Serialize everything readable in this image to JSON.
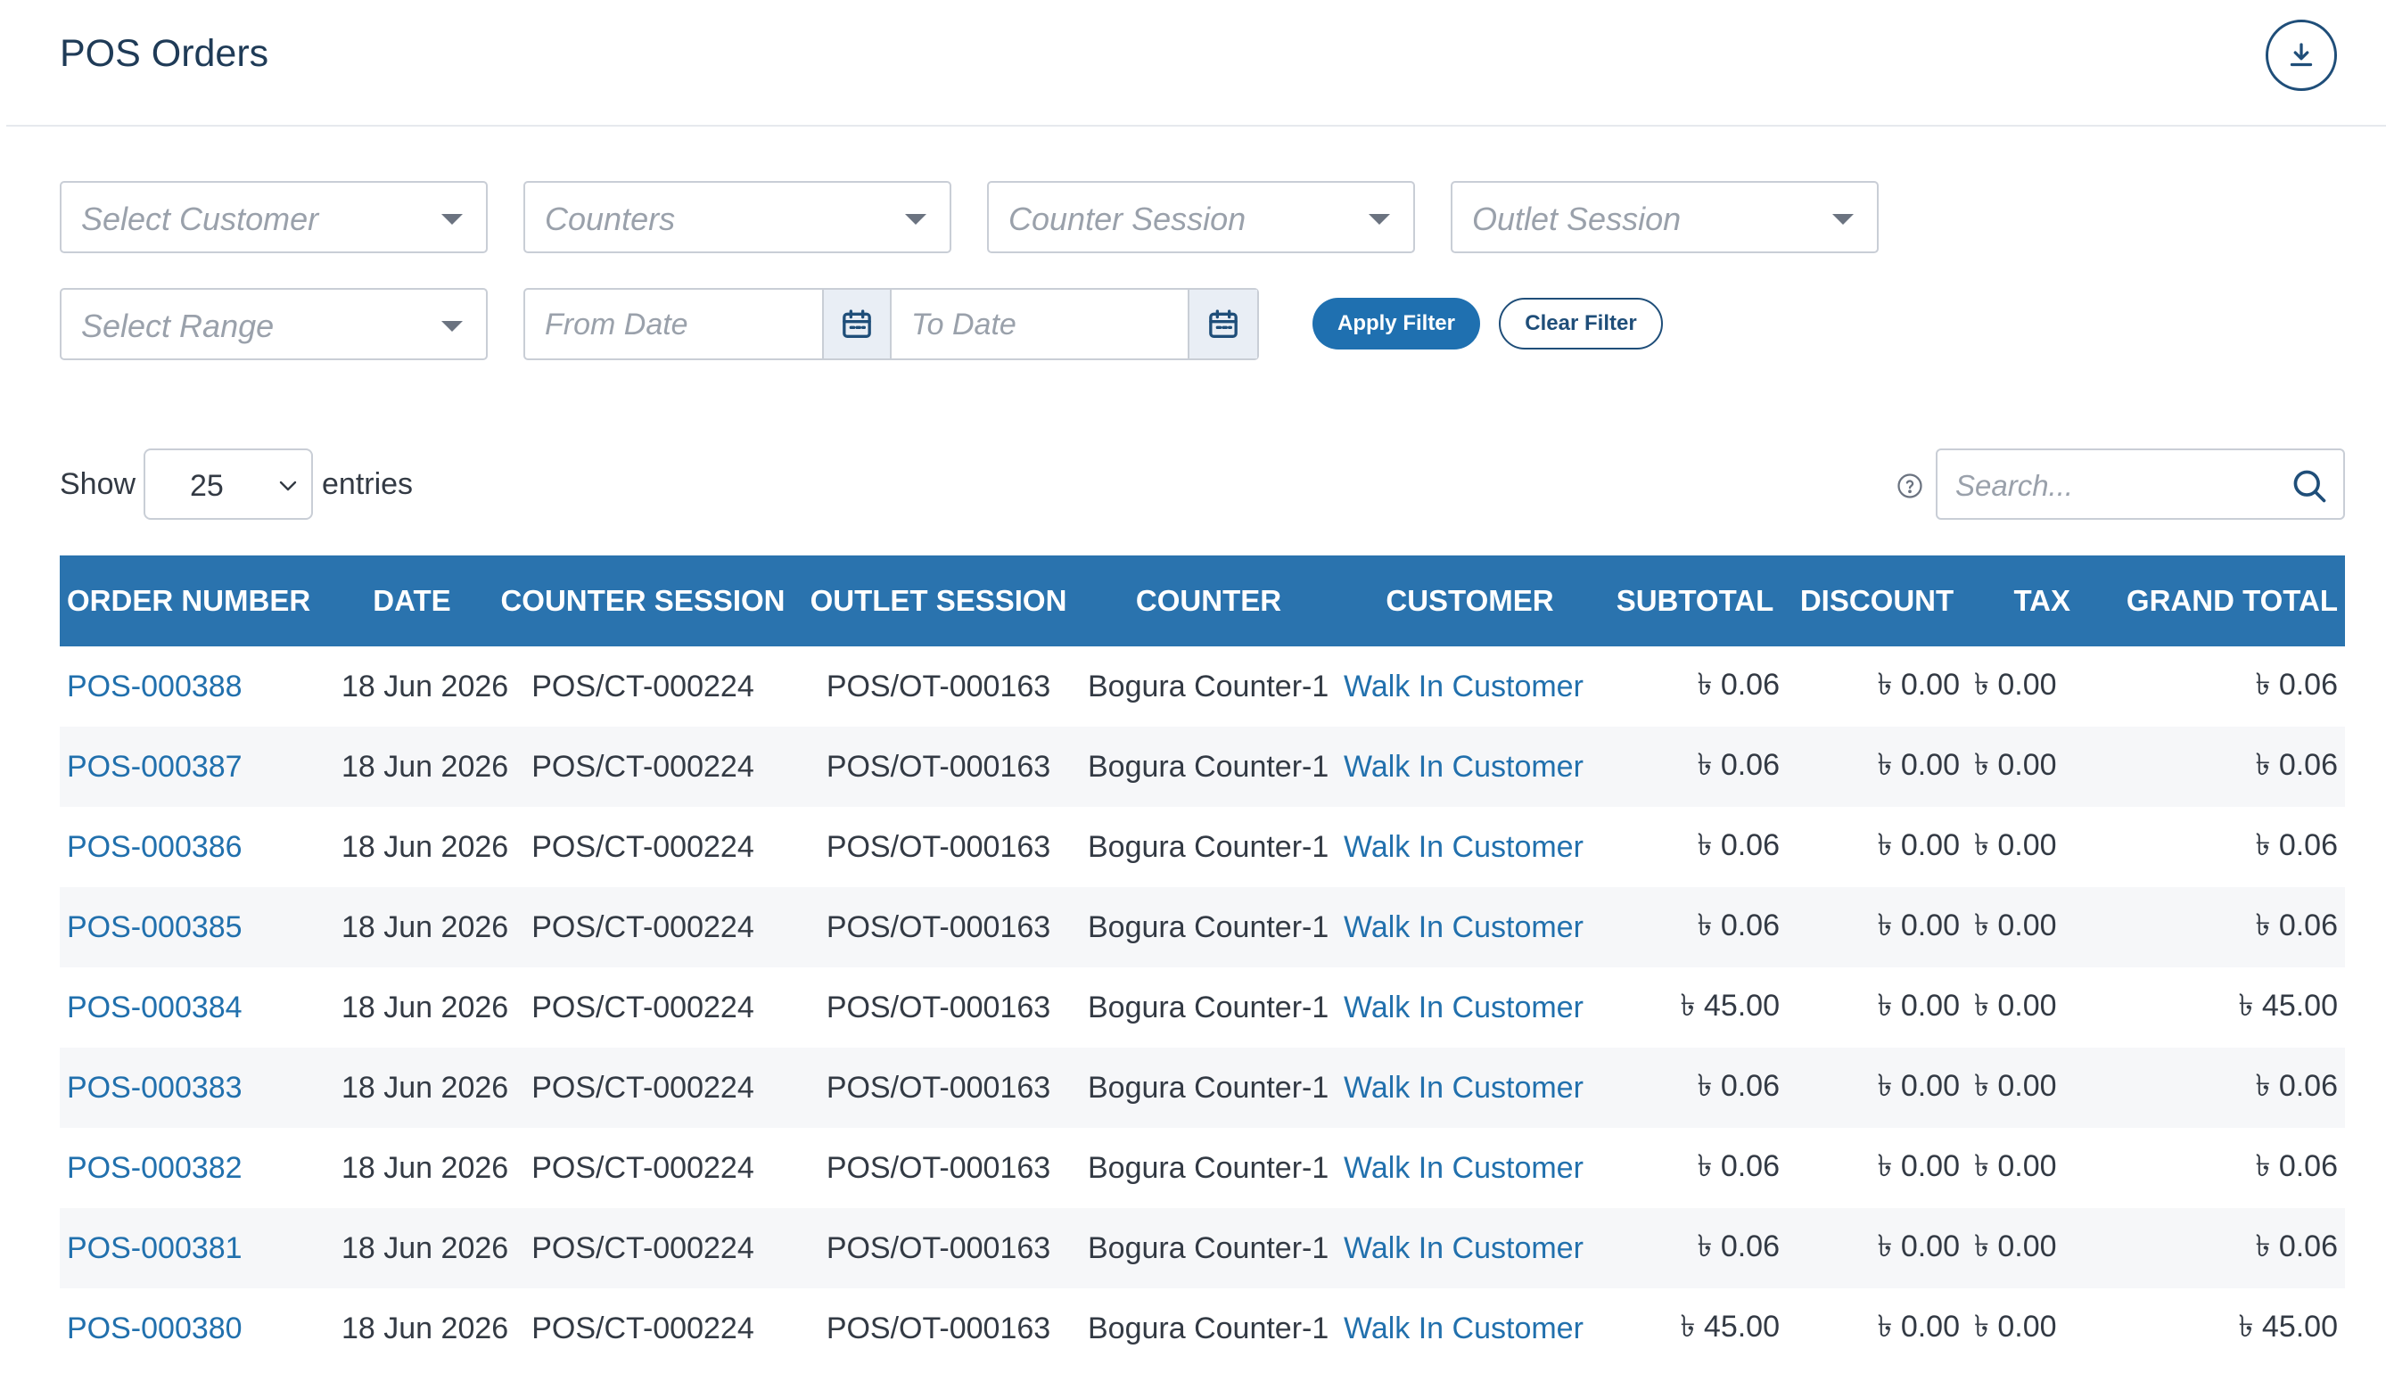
{
  "header": {
    "title": "POS Orders",
    "download_icon": "download-icon"
  },
  "filters": {
    "customer_placeholder": "Select Customer",
    "counters_placeholder": "Counters",
    "counter_session_placeholder": "Counter Session",
    "outlet_session_placeholder": "Outlet Session",
    "range_placeholder": "Select Range",
    "from_date_placeholder": "From Date",
    "to_date_placeholder": "To Date",
    "apply_label": "Apply Filter",
    "clear_label": "Clear Filter"
  },
  "list_controls": {
    "show_label": "Show",
    "entries_value": "25",
    "entries_label": "entries",
    "search_placeholder": "Search..."
  },
  "table": {
    "columns": [
      "ORDER NUMBER",
      "DATE",
      "COUNTER SESSION",
      "OUTLET SESSION",
      "COUNTER",
      "CUSTOMER",
      "SUBTOTAL",
      "DISCOUNT",
      "TAX",
      "GRAND TOTAL"
    ],
    "rows": [
      [
        "POS-000388",
        "18 Jun 2026",
        "POS/CT-000224",
        "POS/OT-000163",
        "Bogura Counter-1",
        "Walk In Customer",
        "৳ 0.06",
        "৳ 0.00",
        "৳ 0.00",
        "৳ 0.06"
      ],
      [
        "POS-000387",
        "18 Jun 2026",
        "POS/CT-000224",
        "POS/OT-000163",
        "Bogura Counter-1",
        "Walk In Customer",
        "৳ 0.06",
        "৳ 0.00",
        "৳ 0.00",
        "৳ 0.06"
      ],
      [
        "POS-000386",
        "18 Jun 2026",
        "POS/CT-000224",
        "POS/OT-000163",
        "Bogura Counter-1",
        "Walk In Customer",
        "৳ 0.06",
        "৳ 0.00",
        "৳ 0.00",
        "৳ 0.06"
      ],
      [
        "POS-000385",
        "18 Jun 2026",
        "POS/CT-000224",
        "POS/OT-000163",
        "Bogura Counter-1",
        "Walk In Customer",
        "৳ 0.06",
        "৳ 0.00",
        "৳ 0.00",
        "৳ 0.06"
      ],
      [
        "POS-000384",
        "18 Jun 2026",
        "POS/CT-000224",
        "POS/OT-000163",
        "Bogura Counter-1",
        "Walk In Customer",
        "৳ 45.00",
        "৳ 0.00",
        "৳ 0.00",
        "৳ 45.00"
      ],
      [
        "POS-000383",
        "18 Jun 2026",
        "POS/CT-000224",
        "POS/OT-000163",
        "Bogura Counter-1",
        "Walk In Customer",
        "৳ 0.06",
        "৳ 0.00",
        "৳ 0.00",
        "৳ 0.06"
      ],
      [
        "POS-000382",
        "18 Jun 2026",
        "POS/CT-000224",
        "POS/OT-000163",
        "Bogura Counter-1",
        "Walk In Customer",
        "৳ 0.06",
        "৳ 0.00",
        "৳ 0.00",
        "৳ 0.06"
      ],
      [
        "POS-000381",
        "18 Jun 2026",
        "POS/CT-000224",
        "POS/OT-000163",
        "Bogura Counter-1",
        "Walk In Customer",
        "৳ 0.06",
        "৳ 0.00",
        "৳ 0.00",
        "৳ 0.06"
      ],
      [
        "POS-000380",
        "18 Jun 2026",
        "POS/CT-000224",
        "POS/OT-000163",
        "Bogura Counter-1",
        "Walk In Customer",
        "৳ 45.00",
        "৳ 0.00",
        "৳ 0.00",
        "৳ 45.00"
      ]
    ]
  },
  "colors": {
    "primary": "#2a73ae",
    "link": "#2170ad",
    "title": "#1f3b57"
  }
}
